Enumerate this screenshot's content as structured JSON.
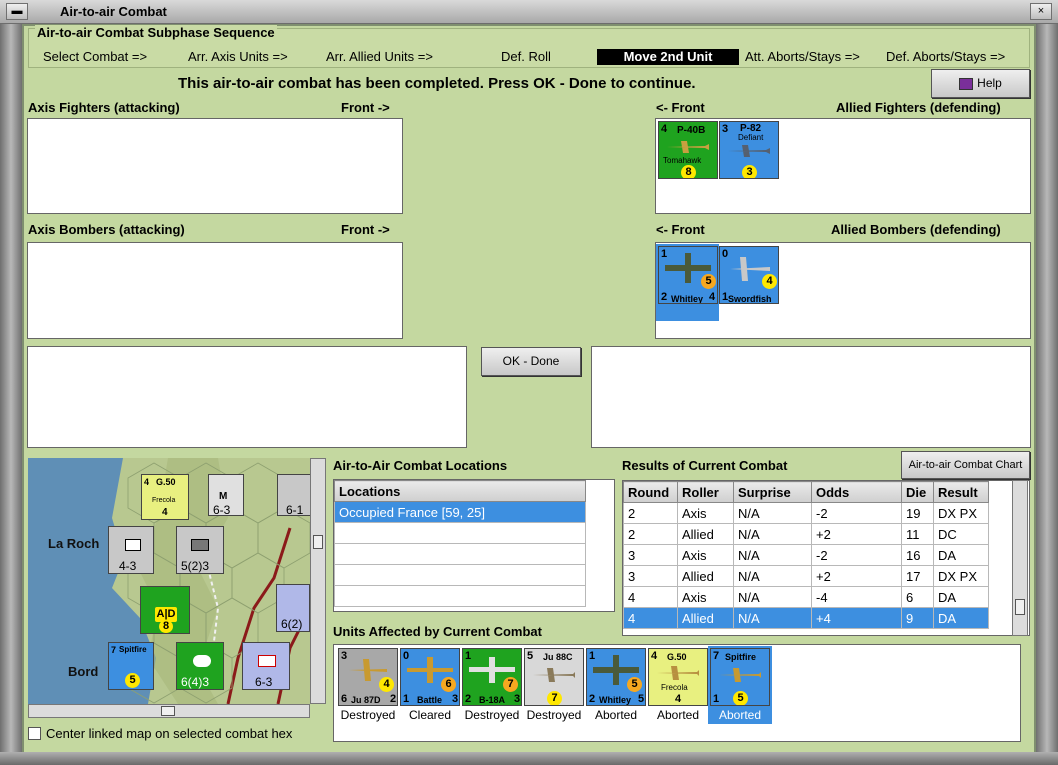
{
  "window": {
    "title": "Air-to-air Combat"
  },
  "sequence": {
    "title": "Air-to-air Combat Subphase Sequence",
    "steps": [
      "Select Combat =>",
      "Arr. Axis Units =>",
      "Arr. Allied Units =>",
      "Def. Roll",
      "Move 2nd Unit",
      "Att. Aborts/Stays =>",
      "Def. Aborts/Stays =>"
    ],
    "active": "Move 2nd Unit"
  },
  "message": "This air-to-air combat has been completed.  Press OK - Done to continue.",
  "help_label": "Help",
  "axis_fighters": {
    "label": "Axis Fighters (attacking)",
    "front": "Front ->"
  },
  "axis_bombers": {
    "label": "Axis Bombers (attacking)",
    "front": "Front ->"
  },
  "allied_fighters": {
    "label": "Allied Fighters (defending)",
    "front": "<- Front",
    "units": [
      {
        "name": "P-40B",
        "sub": "Tomahawk",
        "top": "4",
        "val": "8",
        "color": "#1fa31f"
      },
      {
        "name": "P-82",
        "sub": "Defiant",
        "top": "3",
        "val": "3",
        "color": "#3d8fe0"
      }
    ]
  },
  "allied_bombers": {
    "label": "Allied Bombers (defending)",
    "front": "<- Front",
    "units": [
      {
        "name": "Whitley",
        "top": "1",
        "bl": "2",
        "br": "4",
        "val": "5",
        "color": "#3d8fe0"
      },
      {
        "name": "Swordfish",
        "top": "0",
        "bl": "1",
        "br": "",
        "val": "4",
        "color": "#3d8fe0"
      }
    ]
  },
  "ok_label": "OK - Done",
  "map": {
    "labels": [
      "La Roch",
      "Bord"
    ],
    "center_label": "Center linked map on selected combat hex",
    "hexes": [
      {
        "txt": "4-3",
        "num": "3"
      },
      {
        "txt": "5(2)3",
        "num": "2"
      },
      {
        "txt": "6-3",
        "num": "2"
      },
      {
        "txt": "6(4)3",
        "num": ""
      },
      {
        "txt": "6-3",
        "num": ""
      },
      {
        "txt": "6(2)",
        "num": ""
      },
      {
        "txt": "6-1",
        "num": ""
      }
    ],
    "g50": {
      "name": "G.50",
      "sub": "Frecola",
      "val": "4"
    },
    "stack": {
      "ab": "A|D",
      "val": "8",
      "num": "6"
    },
    "spit": {
      "name": "Spitfire",
      "val": "5",
      "num": "7"
    }
  },
  "locations": {
    "title": "Air-to-Air Combat Locations",
    "header": "Locations",
    "rows": [
      "Occupied France [59, 25]",
      "",
      "",
      "",
      "",
      ""
    ]
  },
  "results": {
    "title": "Results of Current Combat",
    "chart_label": "Air-to-air Combat Chart",
    "columns": [
      "Round",
      "Roller",
      "Surprise",
      "Odds",
      "Die",
      "Result"
    ],
    "rows": [
      [
        "2",
        "Axis",
        "N/A",
        "-2",
        "19",
        "DX PX"
      ],
      [
        "2",
        "Allied",
        "N/A",
        "+2",
        "11",
        "DC"
      ],
      [
        "3",
        "Axis",
        "N/A",
        "-2",
        "16",
        "DA"
      ],
      [
        "3",
        "Allied",
        "N/A",
        "+2",
        "17",
        "DX PX"
      ],
      [
        "4",
        "Axis",
        "N/A",
        "-4",
        "6",
        "DA"
      ],
      [
        "4",
        "Allied",
        "N/A",
        "+4",
        "9",
        "DA"
      ]
    ]
  },
  "affected": {
    "title": "Units Affected by Current Combat",
    "units": [
      {
        "name": "Ju 87D",
        "top": "3",
        "bl": "6",
        "br": "2",
        "val": "4",
        "color": "#a8a8a8",
        "status": "Destroyed"
      },
      {
        "name": "Battle",
        "top": "0",
        "bl": "1",
        "br": "3",
        "val": "6",
        "color": "#3d8fe0",
        "status": "Cleared"
      },
      {
        "name": "B-18A",
        "top": "1",
        "bl": "2",
        "br": "3",
        "val": "7",
        "color": "#1fa31f",
        "status": "Destroyed"
      },
      {
        "name": "Ju 88C",
        "top": "5",
        "bl": "",
        "br": "",
        "val": "7",
        "color": "#d8d8d8",
        "status": "Destroyed"
      },
      {
        "name": "Whitley",
        "top": "1",
        "bl": "2",
        "br": "5",
        "val": "5",
        "color": "#3d8fe0",
        "status": "Aborted"
      },
      {
        "name": "G.50",
        "top": "4",
        "bl": "",
        "br": "",
        "val": "4",
        "color": "#e8f080",
        "status": "Aborted"
      },
      {
        "name": "Spitfire",
        "top": "7",
        "bl": "1",
        "br": "",
        "val": "5",
        "color": "#3d8fe0",
        "status": "Aborted"
      }
    ]
  }
}
